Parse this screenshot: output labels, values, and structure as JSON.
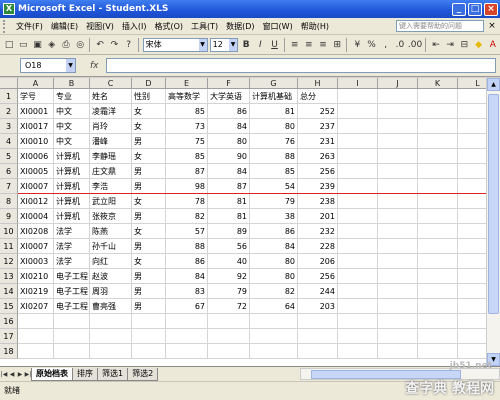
{
  "window": {
    "title": "Microsoft Excel - Student.XLS"
  },
  "menu": {
    "items": [
      "文件(F)",
      "编辑(E)",
      "视图(V)",
      "插入(I)",
      "格式(O)",
      "工具(T)",
      "数据(D)",
      "窗口(W)",
      "帮助(H)"
    ],
    "ask_placeholder": "键入需要帮助的问题"
  },
  "toolbar": {
    "font_name": "宋体",
    "font_size": "12"
  },
  "formula_bar": {
    "cell_ref": "O18",
    "fx": "fx",
    "value": ""
  },
  "columns": [
    "A",
    "B",
    "C",
    "D",
    "E",
    "F",
    "G",
    "H",
    "I",
    "J",
    "K",
    "L"
  ],
  "row_numbers": [
    "1",
    "2",
    "3",
    "4",
    "5",
    "6",
    "7",
    "8",
    "9",
    "10",
    "11",
    "12",
    "13",
    "14",
    "15",
    "16",
    "17",
    "18"
  ],
  "rows": [
    [
      "学号",
      "专业",
      "姓名",
      "性别",
      "高等数学",
      "大学英语",
      "计算机基础",
      "总分"
    ],
    [
      "XI0001",
      "中文",
      "凌霜洋",
      "女",
      "85",
      "86",
      "81",
      "252"
    ],
    [
      "XI0017",
      "中文",
      "肖玲",
      "女",
      "73",
      "84",
      "80",
      "237"
    ],
    [
      "XI0010",
      "中文",
      "潘峰",
      "男",
      "75",
      "80",
      "76",
      "231"
    ],
    [
      "XI0006",
      "计算机",
      "李静瑶",
      "女",
      "85",
      "90",
      "88",
      "263"
    ],
    [
      "XI0005",
      "计算机",
      "庄文鼎",
      "男",
      "87",
      "84",
      "85",
      "256"
    ],
    [
      "XI0007",
      "计算机",
      "李浩",
      "男",
      "98",
      "87",
      "54",
      "239"
    ],
    [
      "XI0012",
      "计算机",
      "武立阳",
      "女",
      "78",
      "81",
      "79",
      "238"
    ],
    [
      "XI0004",
      "计算机",
      "张筱京",
      "男",
      "82",
      "81",
      "38",
      "201"
    ],
    [
      "XI0208",
      "法学",
      "陈燕",
      "女",
      "57",
      "89",
      "86",
      "232"
    ],
    [
      "XI0007",
      "法学",
      "孙千山",
      "男",
      "88",
      "56",
      "84",
      "228"
    ],
    [
      "XI0003",
      "法学",
      "向红",
      "女",
      "86",
      "40",
      "80",
      "206"
    ],
    [
      "XI0210",
      "电子工程",
      "赵波",
      "男",
      "84",
      "92",
      "80",
      "256"
    ],
    [
      "XI0219",
      "电子工程",
      "周羽",
      "男",
      "83",
      "79",
      "82",
      "244"
    ],
    [
      "XI0207",
      "电子工程",
      "曹亮强",
      "男",
      "67",
      "72",
      "64",
      "203"
    ],
    [
      "",
      "",
      "",
      "",
      "",
      "",
      "",
      ""
    ],
    [
      "",
      "",
      "",
      "",
      "",
      "",
      "",
      ""
    ],
    [
      "",
      "",
      "",
      "",
      "",
      "",
      "",
      ""
    ]
  ],
  "sheet_tabs": [
    "原始档表",
    "排序",
    "筛选1",
    "筛选2"
  ],
  "status": {
    "text": "就绪"
  },
  "watermark": {
    "text": "查字典 教程网",
    "url": "jb51.net"
  }
}
